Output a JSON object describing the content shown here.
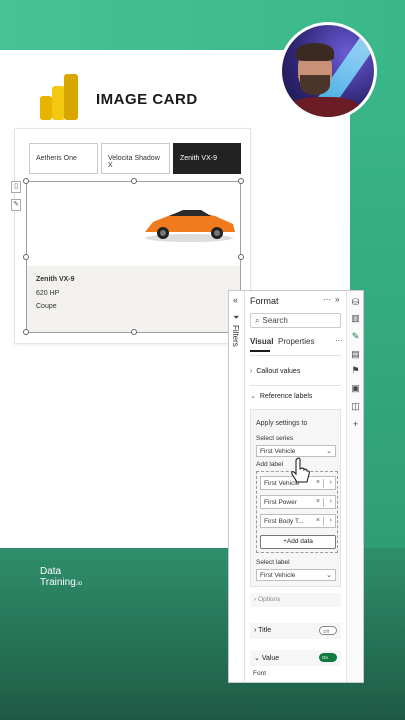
{
  "page": {
    "heading": "IMAGE CARD",
    "brand_line1": "Data",
    "brand_line2": "Training",
    "brand_suffix": ".io"
  },
  "colors": {
    "accent_green": "#3ab889",
    "dark_green": "#1f5a45",
    "powerbi_yellow": "#f2c811",
    "toggle_on": "#117a3e"
  },
  "card": {
    "tabs": [
      {
        "label": "Aetheris One",
        "active": false
      },
      {
        "label": "Velocita Shadow X",
        "active": false
      },
      {
        "label": "Zenith VX-9",
        "active": true
      }
    ],
    "image_icon": "orange-sports-car",
    "name": "Zenith VX-9",
    "power": "620 HP",
    "body_type": "Coupe"
  },
  "format_pane": {
    "filters_label": "Filters",
    "title": "Format",
    "more_icon": "ellipsis-icon",
    "search_placeholder": "Search",
    "tabs": [
      {
        "label": "Visual",
        "active": true
      },
      {
        "label": "Properties",
        "active": false
      }
    ],
    "sections": {
      "callout_values": "Callout values",
      "reference_labels": "Reference labels"
    },
    "apply_settings_label": "Apply settings to",
    "select_series_label": "Select series",
    "select_series_value": "First Vehicle",
    "add_label_label": "Add label",
    "labels": [
      "First Vehicle",
      "First Power",
      "First Body T..."
    ],
    "add_data_button": "+Add data",
    "select_label_label": "Select label",
    "select_label_value": "First Vehicle",
    "options_label": "Options",
    "title_row": {
      "label": "Title",
      "toggle": "Off"
    },
    "value_row": {
      "label": "Value",
      "toggle": "On"
    },
    "font_label": "Font"
  }
}
